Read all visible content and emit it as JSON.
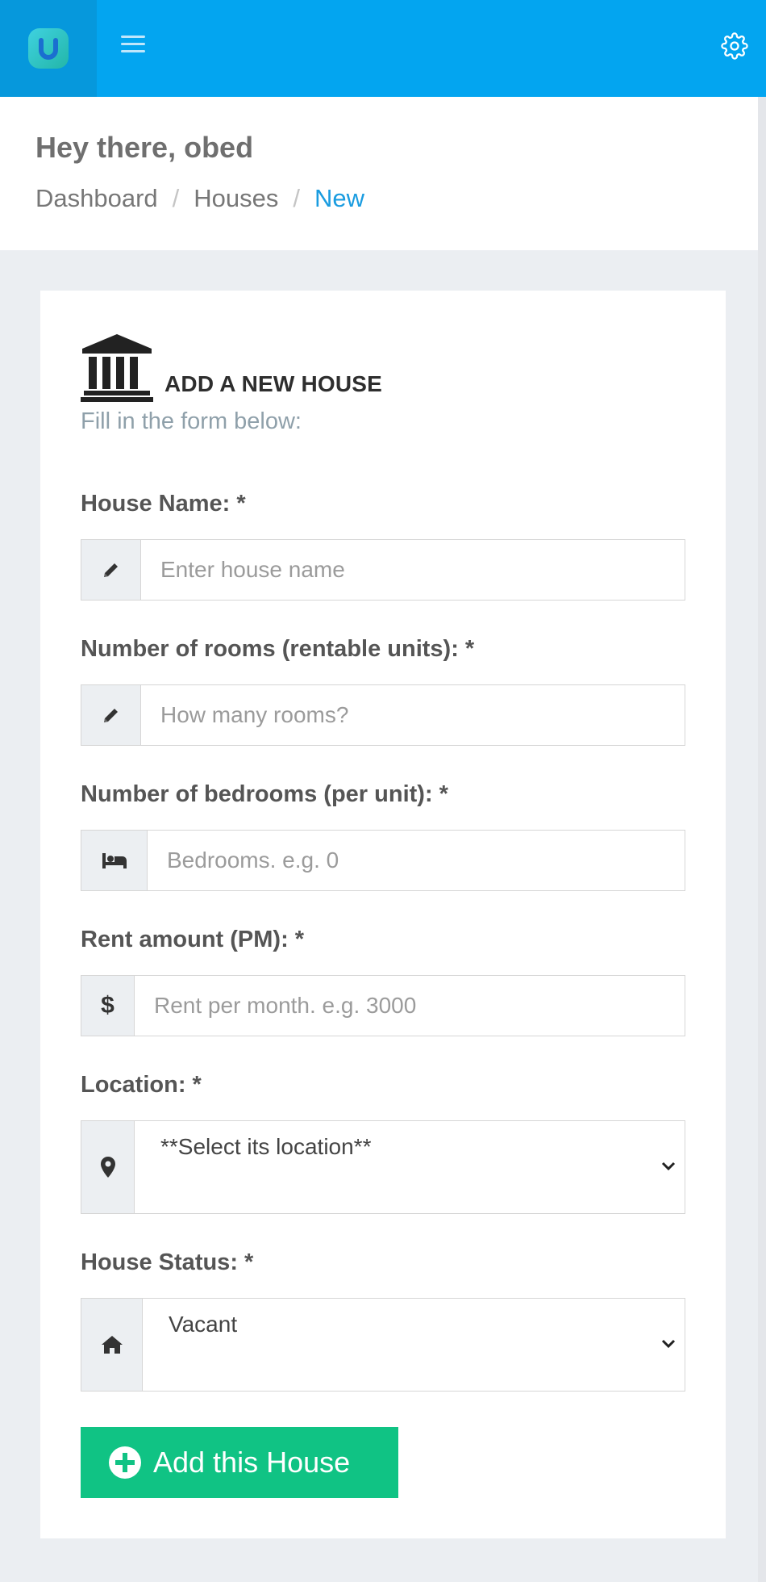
{
  "header": {
    "greeting": "Hey there, obed"
  },
  "breadcrumb": [
    {
      "label": "Dashboard"
    },
    {
      "label": "Houses"
    },
    {
      "label": "New",
      "active": true
    }
  ],
  "form": {
    "title": "ADD A NEW HOUSE",
    "subtitle": "Fill in the form below:",
    "fields": {
      "name": {
        "label": "House Name: *",
        "placeholder": "Enter house name",
        "icon": "pencil-icon"
      },
      "rooms": {
        "label": "Number of rooms (rentable units): *",
        "placeholder": "How many rooms?",
        "icon": "pencil-icon"
      },
      "bedrooms": {
        "label": "Number of bedrooms (per unit): *",
        "placeholder": "Bedrooms. e.g. 0",
        "icon": "bed-icon"
      },
      "rent": {
        "label": "Rent amount (PM): *",
        "placeholder": "Rent per month. e.g. 3000",
        "icon": "dollar-icon",
        "symbol": "$"
      },
      "location": {
        "label": "Location: *",
        "selected": "**Select its location**",
        "icon": "map-pin-icon"
      },
      "status": {
        "label": "House Status: *",
        "selected": "Vacant",
        "icon": "home-icon"
      }
    },
    "submit_label": "Add this House"
  },
  "colors": {
    "topbar": "#03a5f0",
    "accent": "#1a9ce0",
    "submit": "#10c384"
  }
}
